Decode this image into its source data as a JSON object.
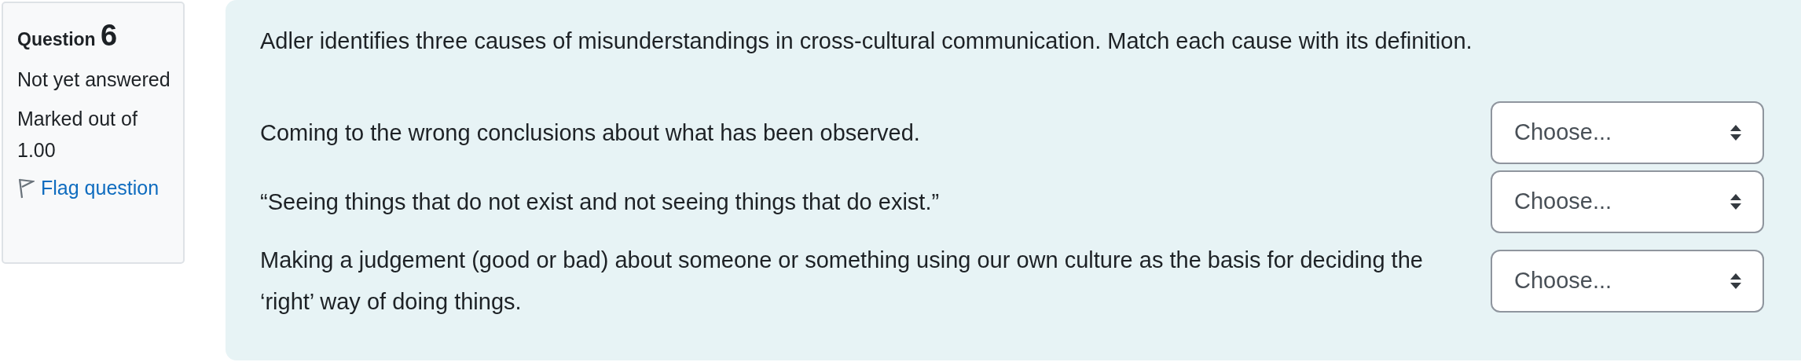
{
  "info": {
    "label": "Question",
    "number": "6",
    "status": "Not yet answered",
    "marks": "Marked out of 1.00",
    "flag_link": "Flag question"
  },
  "prompt": "Adler identifies three causes of misunderstandings in cross-cultural communication. Match each cause with its definition.",
  "matches": [
    {
      "text": "Coming to the wrong conclusions about what has been observed.",
      "dropdown": "Choose..."
    },
    {
      "text": "“Seeing things that do not exist and not seeing things that do exist.”",
      "dropdown": "Choose..."
    },
    {
      "text": "Making a judgement (good or bad) about someone or something using our own culture as the basis for deciding the ‘right’ way of doing things.",
      "dropdown": "Choose..."
    }
  ]
}
